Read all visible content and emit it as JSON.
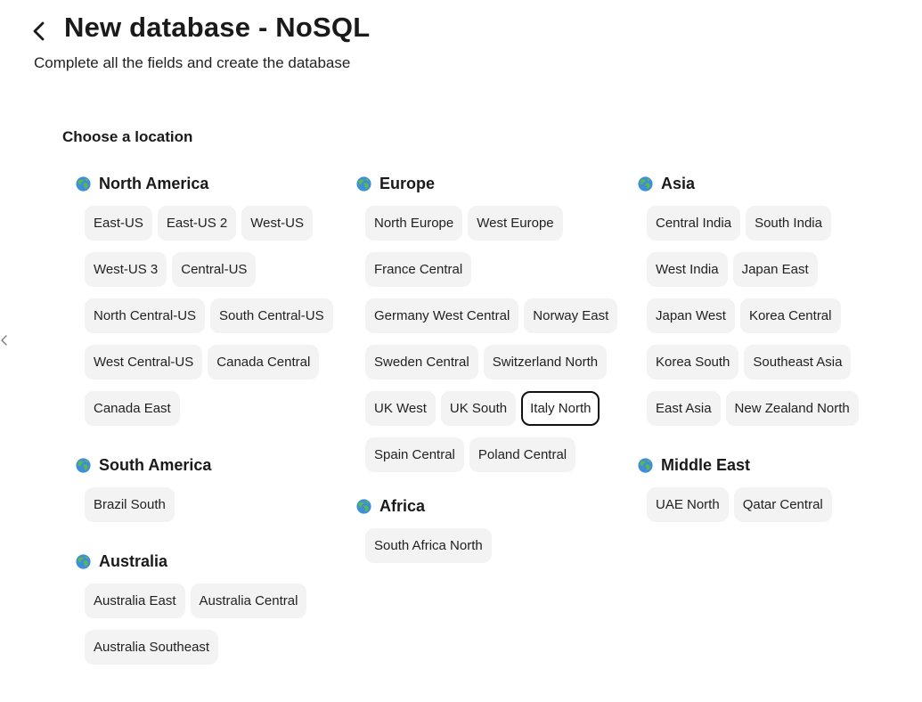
{
  "header": {
    "title": "New database - NoSQL",
    "subtitle": "Complete all the fields and create the database"
  },
  "location": {
    "label": "Choose a location",
    "selected": "Italy North",
    "regions": [
      {
        "name": "North America",
        "locations": [
          "East-US",
          "East-US 2",
          "West-US",
          "West-US 3",
          "Central-US",
          "North Central-US",
          "South Central-US",
          "West Central-US",
          "Canada Central",
          "Canada East"
        ]
      },
      {
        "name": "South America",
        "locations": [
          "Brazil South"
        ]
      },
      {
        "name": "Australia",
        "locations": [
          "Australia East",
          "Australia Central",
          "Australia Southeast"
        ]
      },
      {
        "name": "Europe",
        "locations": [
          "North Europe",
          "West Europe",
          "France Central",
          "Germany West Central",
          "Norway East",
          "Sweden Central",
          "Switzerland North",
          "UK West",
          "UK South",
          "Italy North",
          "Spain Central",
          "Poland Central"
        ]
      },
      {
        "name": "Africa",
        "locations": [
          "South Africa North"
        ]
      },
      {
        "name": "Asia",
        "locations": [
          "Central India",
          "South India",
          "West India",
          "Japan East",
          "Japan West",
          "Korea Central",
          "Korea South",
          "Southeast Asia",
          "East Asia",
          "New Zealand North"
        ]
      },
      {
        "name": "Middle East",
        "locations": [
          "UAE North",
          "Qatar Central"
        ]
      }
    ]
  },
  "icons": {
    "back": "chevron-left-icon",
    "region": "globe-icon",
    "side_handle": "chevron-left-icon"
  },
  "colors": {
    "chip_background": "#f3f3f3",
    "selected_border": "#111111"
  }
}
